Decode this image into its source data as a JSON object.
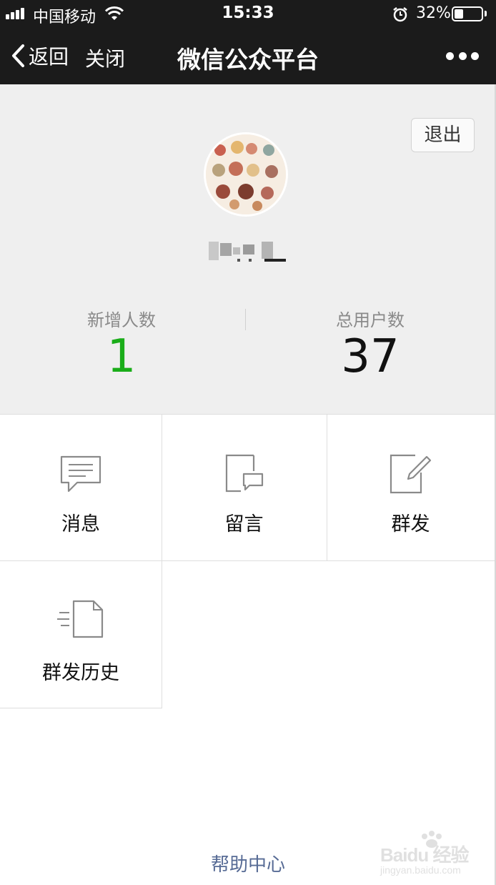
{
  "status_bar": {
    "carrier": "中国移动",
    "time": "15:33",
    "battery_percent": "32%",
    "battery_level": 0.32
  },
  "nav": {
    "back_label": "返回",
    "close_label": "关闭",
    "title": "微信公众平台"
  },
  "profile": {
    "logout_label": "退出",
    "stats": {
      "new_users_label": "新增人数",
      "new_users_value": "1",
      "total_users_label": "总用户数",
      "total_users_value": "37"
    }
  },
  "menu": {
    "messages": "消息",
    "comments": "留言",
    "broadcast": "群发",
    "broadcast_history": "群发历史"
  },
  "footer": {
    "help_label": "帮助中心"
  },
  "watermark": {
    "brand": "Baidu 经验",
    "url": "jingyan.baidu.com"
  },
  "colors": {
    "nav_bg": "#1b1b1b",
    "profile_bg": "#efefef",
    "accent_green": "#1aad19",
    "link_blue": "#576b95"
  }
}
